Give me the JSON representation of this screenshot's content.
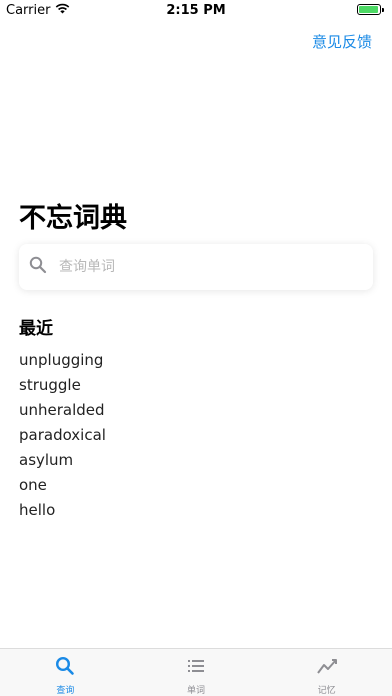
{
  "status_bar": {
    "carrier": "Carrier",
    "time": "2:15 PM",
    "battery_level": 0.95
  },
  "header": {
    "feedback_label": "意见反馈"
  },
  "main": {
    "title": "不忘词典",
    "search": {
      "placeholder": "查询单词",
      "value": ""
    },
    "recent": {
      "title": "最近",
      "items": [
        "unplugging",
        "struggle",
        "unheralded",
        "paradoxical",
        "asylum",
        "one",
        "hello"
      ]
    }
  },
  "tab_bar": {
    "tabs": [
      {
        "label": "查询",
        "icon": "search-icon",
        "active": true
      },
      {
        "label": "单词",
        "icon": "list-icon",
        "active": false
      },
      {
        "label": "记忆",
        "icon": "chart-icon",
        "active": false
      }
    ]
  },
  "colors": {
    "accent": "#1a8ae6",
    "inactive": "#8e8e93",
    "battery": "#4cd964"
  }
}
